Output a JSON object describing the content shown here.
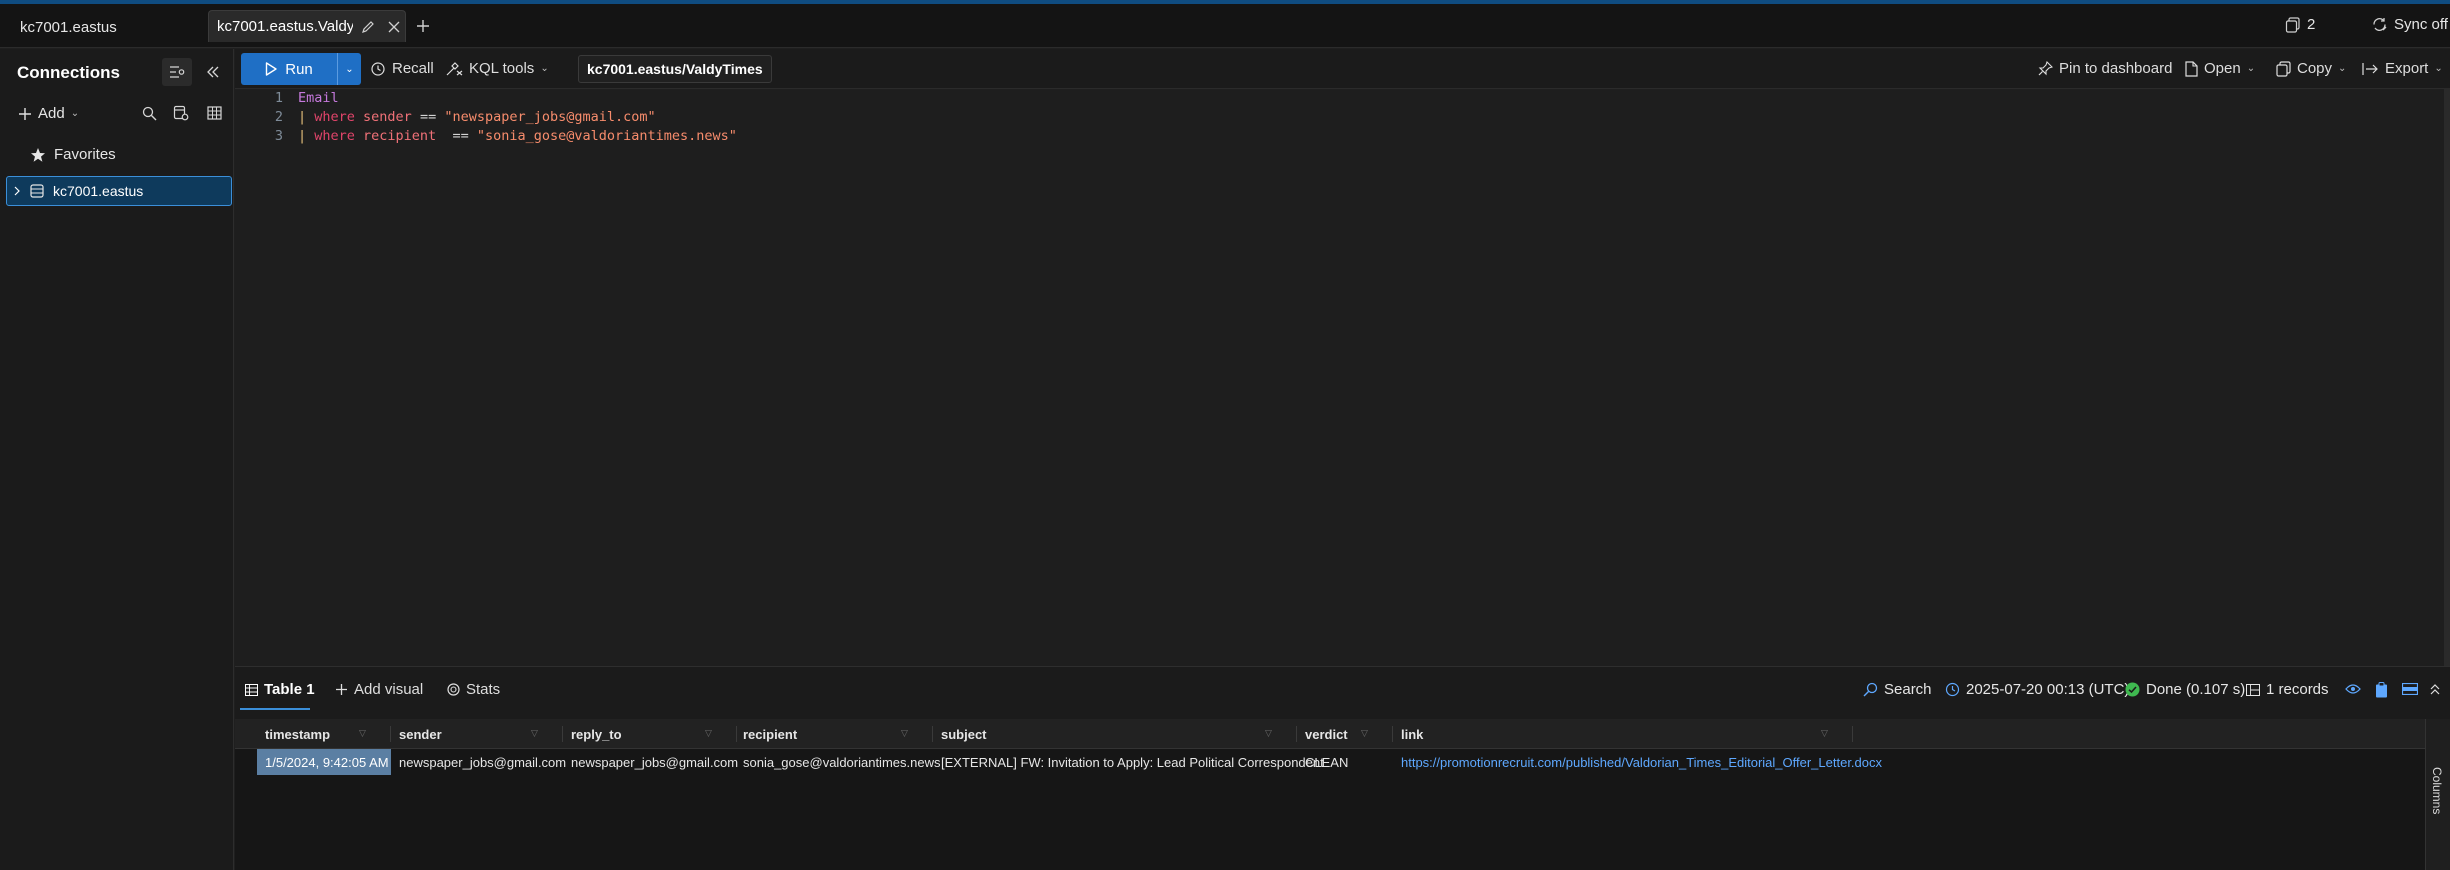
{
  "titlebar": {
    "cluster": "kc7001.eastus",
    "tab_label": "kc7001.eastus.Valdy...",
    "tab_count": "2",
    "sync_label": "Sync off"
  },
  "sidebar": {
    "title": "Connections",
    "add_label": "Add",
    "favorites_label": "Favorites",
    "connection": "kc7001.eastus"
  },
  "toolbar": {
    "run_label": "Run",
    "recall_label": "Recall",
    "kql_tools_label": "KQL tools",
    "database": "kc7001.eastus/ValdyTimes",
    "pin_label": "Pin to dashboard",
    "open_label": "Open",
    "copy_label": "Copy",
    "export_label": "Export"
  },
  "editor": {
    "line_numbers": [
      "1",
      "2",
      "3"
    ],
    "line1": {
      "table": "Email"
    },
    "line2": {
      "pipe": "| ",
      "kw": "where",
      "col": " sender",
      "op": " == ",
      "str": "\"newspaper_jobs@gmail.com\""
    },
    "line3": {
      "pipe": "| ",
      "kw": "where",
      "col": " recipient",
      "op": "  == ",
      "str": "\"sonia_gose@valdoriantimes.news\""
    }
  },
  "results": {
    "tabs": [
      "Table 1",
      "Add visual",
      "Stats"
    ],
    "search_label": "Search",
    "timestamp": "2025-07-20 00:13 (UTC)",
    "status": "Done (0.107 s)",
    "records": "1 records",
    "columns_tab": "Columns",
    "columns": [
      "timestamp",
      "sender",
      "reply_to",
      "recipient",
      "subject",
      "verdict",
      "link"
    ],
    "rows": [
      [
        "1/5/2024, 9:42:05 AM",
        "newspaper_jobs@gmail.com",
        "newspaper_jobs@gmail.com",
        "sonia_gose@valdoriantimes.news",
        "[EXTERNAL] FW: Invitation to Apply: Lead Political Correspondent",
        "CLEAN",
        "https://promotionrecruit.com/published/Valdorian_Times_Editorial_Offer_Letter.docx"
      ]
    ]
  },
  "colors": {
    "accent": "#1f6fc5",
    "selected_connection": "#0e3a5c",
    "link": "#5ea8ff",
    "done": "#3fb950"
  }
}
